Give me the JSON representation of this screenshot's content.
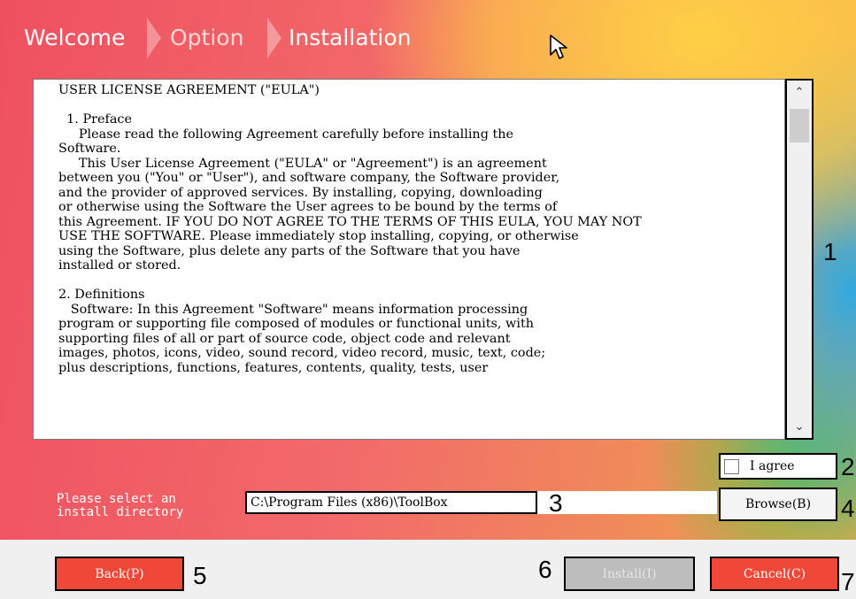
{
  "steps": {
    "welcome": "Welcome",
    "option": "Option",
    "installation": "Installation"
  },
  "eula": {
    "text": "USER LICENSE AGREEMENT (\"EULA\")\n\n  1. Preface\n     Please read the following Agreement carefully before installing the\nSoftware.\n     This User License Agreement (\"EULA\" or \"Agreement\") is an agreement\nbetween you (\"You\" or \"User\"), and software company, the Software provider,\nand the provider of approved services. By installing, copying, downloading\nor otherwise using the Software the User agrees to be bound by the terms of\nthis Agreement. IF YOU DO NOT AGREE TO THE TERMS OF THIS EULA, YOU MAY NOT\nUSE THE SOFTWARE. Please immediately stop installing, copying, or otherwise\nusing the Software, plus delete any parts of the Software that you have\ninstalled or stored.\n\n2. Definitions\n   Software: In this Agreement \"Software\" means information processing\nprogram or supporting file composed of modules or functional units, with\nsupporting files of all or part of source code, object code and relevant\nimages, photos, icons, video, sound record, video record, music, text, code;\nplus descriptions, functions, features, contents, quality, tests, user"
  },
  "scrollbar": {
    "up": "⌃",
    "down": "⌄"
  },
  "agree": {
    "label": "I agree",
    "checked": false
  },
  "directory": {
    "label": "Please select an\ninstall directory",
    "path": "C:\\Program Files (x86)\\ToolBox"
  },
  "buttons": {
    "browse": "Browse(B)",
    "back": "Back(P)",
    "install": "Install(I)",
    "cancel": "Cancel(C)"
  },
  "annotations": [
    "1",
    "2",
    "3",
    "4",
    "5",
    "6",
    "7"
  ],
  "icons": {
    "cursor": "mouse-pointer-icon"
  },
  "colors": {
    "button_red": "#f04838",
    "disabled_gray": "#bdbdbd",
    "bottom_bar": "#f0f0f0"
  }
}
